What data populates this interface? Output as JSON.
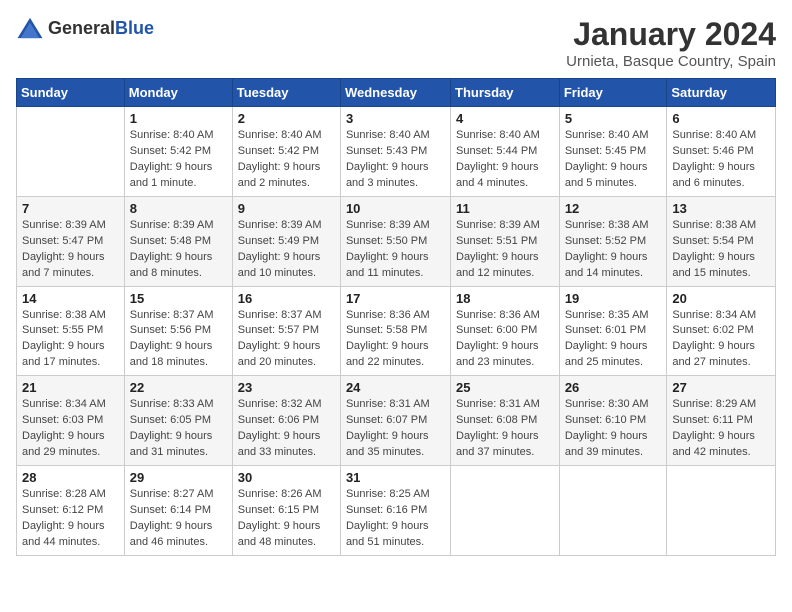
{
  "header": {
    "logo_general": "General",
    "logo_blue": "Blue",
    "main_title": "January 2024",
    "subtitle": "Urnieta, Basque Country, Spain"
  },
  "calendar": {
    "days_of_week": [
      "Sunday",
      "Monday",
      "Tuesday",
      "Wednesday",
      "Thursday",
      "Friday",
      "Saturday"
    ],
    "weeks": [
      [
        {
          "day": "",
          "info": ""
        },
        {
          "day": "1",
          "info": "Sunrise: 8:40 AM\nSunset: 5:42 PM\nDaylight: 9 hours\nand 1 minute."
        },
        {
          "day": "2",
          "info": "Sunrise: 8:40 AM\nSunset: 5:42 PM\nDaylight: 9 hours\nand 2 minutes."
        },
        {
          "day": "3",
          "info": "Sunrise: 8:40 AM\nSunset: 5:43 PM\nDaylight: 9 hours\nand 3 minutes."
        },
        {
          "day": "4",
          "info": "Sunrise: 8:40 AM\nSunset: 5:44 PM\nDaylight: 9 hours\nand 4 minutes."
        },
        {
          "day": "5",
          "info": "Sunrise: 8:40 AM\nSunset: 5:45 PM\nDaylight: 9 hours\nand 5 minutes."
        },
        {
          "day": "6",
          "info": "Sunrise: 8:40 AM\nSunset: 5:46 PM\nDaylight: 9 hours\nand 6 minutes."
        }
      ],
      [
        {
          "day": "7",
          "info": "Sunrise: 8:39 AM\nSunset: 5:47 PM\nDaylight: 9 hours\nand 7 minutes."
        },
        {
          "day": "8",
          "info": "Sunrise: 8:39 AM\nSunset: 5:48 PM\nDaylight: 9 hours\nand 8 minutes."
        },
        {
          "day": "9",
          "info": "Sunrise: 8:39 AM\nSunset: 5:49 PM\nDaylight: 9 hours\nand 10 minutes."
        },
        {
          "day": "10",
          "info": "Sunrise: 8:39 AM\nSunset: 5:50 PM\nDaylight: 9 hours\nand 11 minutes."
        },
        {
          "day": "11",
          "info": "Sunrise: 8:39 AM\nSunset: 5:51 PM\nDaylight: 9 hours\nand 12 minutes."
        },
        {
          "day": "12",
          "info": "Sunrise: 8:38 AM\nSunset: 5:52 PM\nDaylight: 9 hours\nand 14 minutes."
        },
        {
          "day": "13",
          "info": "Sunrise: 8:38 AM\nSunset: 5:54 PM\nDaylight: 9 hours\nand 15 minutes."
        }
      ],
      [
        {
          "day": "14",
          "info": "Sunrise: 8:38 AM\nSunset: 5:55 PM\nDaylight: 9 hours\nand 17 minutes."
        },
        {
          "day": "15",
          "info": "Sunrise: 8:37 AM\nSunset: 5:56 PM\nDaylight: 9 hours\nand 18 minutes."
        },
        {
          "day": "16",
          "info": "Sunrise: 8:37 AM\nSunset: 5:57 PM\nDaylight: 9 hours\nand 20 minutes."
        },
        {
          "day": "17",
          "info": "Sunrise: 8:36 AM\nSunset: 5:58 PM\nDaylight: 9 hours\nand 22 minutes."
        },
        {
          "day": "18",
          "info": "Sunrise: 8:36 AM\nSunset: 6:00 PM\nDaylight: 9 hours\nand 23 minutes."
        },
        {
          "day": "19",
          "info": "Sunrise: 8:35 AM\nSunset: 6:01 PM\nDaylight: 9 hours\nand 25 minutes."
        },
        {
          "day": "20",
          "info": "Sunrise: 8:34 AM\nSunset: 6:02 PM\nDaylight: 9 hours\nand 27 minutes."
        }
      ],
      [
        {
          "day": "21",
          "info": "Sunrise: 8:34 AM\nSunset: 6:03 PM\nDaylight: 9 hours\nand 29 minutes."
        },
        {
          "day": "22",
          "info": "Sunrise: 8:33 AM\nSunset: 6:05 PM\nDaylight: 9 hours\nand 31 minutes."
        },
        {
          "day": "23",
          "info": "Sunrise: 8:32 AM\nSunset: 6:06 PM\nDaylight: 9 hours\nand 33 minutes."
        },
        {
          "day": "24",
          "info": "Sunrise: 8:31 AM\nSunset: 6:07 PM\nDaylight: 9 hours\nand 35 minutes."
        },
        {
          "day": "25",
          "info": "Sunrise: 8:31 AM\nSunset: 6:08 PM\nDaylight: 9 hours\nand 37 minutes."
        },
        {
          "day": "26",
          "info": "Sunrise: 8:30 AM\nSunset: 6:10 PM\nDaylight: 9 hours\nand 39 minutes."
        },
        {
          "day": "27",
          "info": "Sunrise: 8:29 AM\nSunset: 6:11 PM\nDaylight: 9 hours\nand 42 minutes."
        }
      ],
      [
        {
          "day": "28",
          "info": "Sunrise: 8:28 AM\nSunset: 6:12 PM\nDaylight: 9 hours\nand 44 minutes."
        },
        {
          "day": "29",
          "info": "Sunrise: 8:27 AM\nSunset: 6:14 PM\nDaylight: 9 hours\nand 46 minutes."
        },
        {
          "day": "30",
          "info": "Sunrise: 8:26 AM\nSunset: 6:15 PM\nDaylight: 9 hours\nand 48 minutes."
        },
        {
          "day": "31",
          "info": "Sunrise: 8:25 AM\nSunset: 6:16 PM\nDaylight: 9 hours\nand 51 minutes."
        },
        {
          "day": "",
          "info": ""
        },
        {
          "day": "",
          "info": ""
        },
        {
          "day": "",
          "info": ""
        }
      ]
    ]
  }
}
